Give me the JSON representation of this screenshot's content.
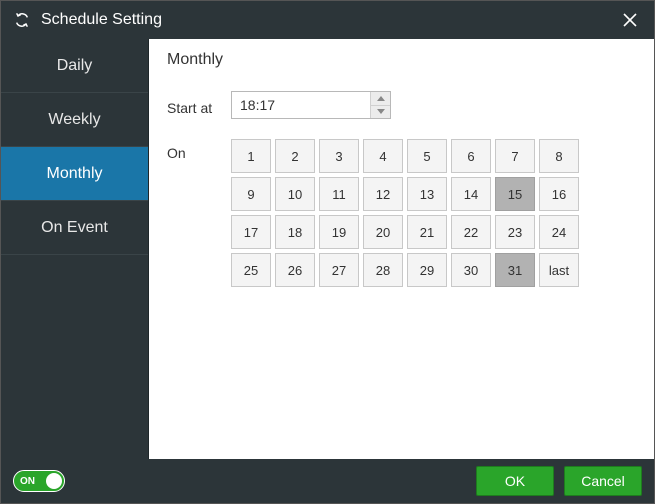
{
  "window": {
    "title": "Schedule Setting"
  },
  "sidebar": {
    "items": [
      {
        "label": "Daily",
        "active": false
      },
      {
        "label": "Weekly",
        "active": false
      },
      {
        "label": "Monthly",
        "active": true
      },
      {
        "label": "On Event",
        "active": false
      }
    ]
  },
  "content": {
    "title": "Monthly",
    "start_at_label": "Start at",
    "start_at_value": "18:17",
    "on_label": "On",
    "days": [
      {
        "label": "1",
        "selected": false
      },
      {
        "label": "2",
        "selected": false
      },
      {
        "label": "3",
        "selected": false
      },
      {
        "label": "4",
        "selected": false
      },
      {
        "label": "5",
        "selected": false
      },
      {
        "label": "6",
        "selected": false
      },
      {
        "label": "7",
        "selected": false
      },
      {
        "label": "8",
        "selected": false
      },
      {
        "label": "9",
        "selected": false
      },
      {
        "label": "10",
        "selected": false
      },
      {
        "label": "11",
        "selected": false
      },
      {
        "label": "12",
        "selected": false
      },
      {
        "label": "13",
        "selected": false
      },
      {
        "label": "14",
        "selected": false
      },
      {
        "label": "15",
        "selected": true
      },
      {
        "label": "16",
        "selected": false
      },
      {
        "label": "17",
        "selected": false
      },
      {
        "label": "18",
        "selected": false
      },
      {
        "label": "19",
        "selected": false
      },
      {
        "label": "20",
        "selected": false
      },
      {
        "label": "21",
        "selected": false
      },
      {
        "label": "22",
        "selected": false
      },
      {
        "label": "23",
        "selected": false
      },
      {
        "label": "24",
        "selected": false
      },
      {
        "label": "25",
        "selected": false
      },
      {
        "label": "26",
        "selected": false
      },
      {
        "label": "27",
        "selected": false
      },
      {
        "label": "28",
        "selected": false
      },
      {
        "label": "29",
        "selected": false
      },
      {
        "label": "30",
        "selected": false
      },
      {
        "label": "31",
        "selected": true
      },
      {
        "label": "last",
        "selected": false
      }
    ]
  },
  "footer": {
    "toggle_label": "ON",
    "toggle_state": true,
    "ok_label": "OK",
    "cancel_label": "Cancel"
  }
}
